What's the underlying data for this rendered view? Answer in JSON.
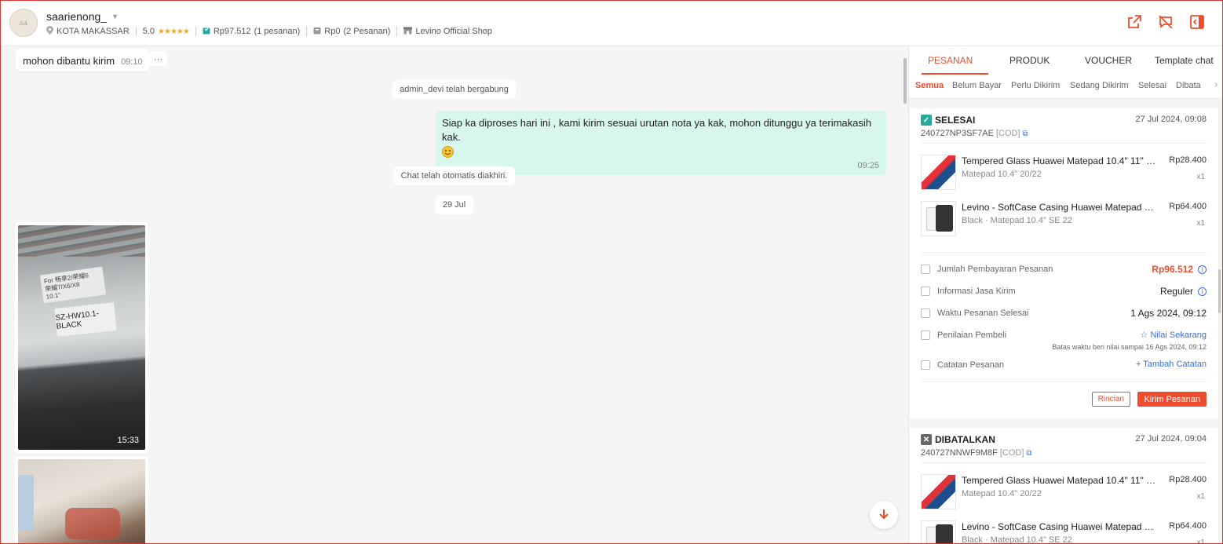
{
  "header": {
    "username": "saarienong_",
    "location": "KOTA MAKASSAR",
    "rating": "5.0",
    "stars": "★★★★★",
    "purchase_total": "Rp97.512",
    "purchase_count": "(1 pesanan)",
    "pending_total": "Rp0",
    "pending_count": "(2 Pesanan)",
    "shop": "Levino Official Shop",
    "avatar_text": "ꜱᴀ"
  },
  "chat": {
    "messages": [
      {
        "type": "received",
        "text": "mohon dibantu kirim",
        "time": "09:10"
      },
      {
        "type": "system",
        "text": "admin_devi telah bergabung"
      },
      {
        "type": "sent",
        "text": "Siap ka diproses hari ini , kami kirim sesuai urutan nota ya kak, mohon ditunggu ya terimakasih kak.",
        "time": "09:25"
      },
      {
        "type": "system",
        "text": "Chat telah otomatis diakhiri."
      },
      {
        "type": "date",
        "text": "29 Jul"
      },
      {
        "type": "video",
        "duration": "15:33",
        "label1": "For 畅享2/荣耀6\n荣耀7/X6/X8\n10.1\"",
        "label2": "SZ-HW10.1-BLACK"
      },
      {
        "type": "image"
      }
    ],
    "more_label": "···",
    "scroll_down_icon": "arrow-down-icon"
  },
  "panel": {
    "tabs": [
      "PESANAN",
      "PRODUK",
      "VOUCHER",
      "Template chat"
    ],
    "active_tab": 0,
    "subtabs": [
      "Semua",
      "Belum Bayar",
      "Perlu Dikirim",
      "Sedang Dikirim",
      "Selesai",
      "Dibata"
    ],
    "active_subtab": 0,
    "orders": [
      {
        "status": "SELESAI",
        "date": "27 Jul 2024, 09:08",
        "order_id": "240727NP3SF7AE",
        "cod": "[COD]",
        "items": [
          {
            "name": "Tempered Glass Huawei Matepad 10.4\" 11\" Pr...",
            "variant": "Matepad 10.4\" 20/22",
            "price": "Rp28.400",
            "qty": "x1"
          },
          {
            "name": "Levino - SoftCase Casing Huawei Matepad 11....",
            "variant": "Black · Matepad 10.4\" SE 22",
            "price": "Rp64.400",
            "qty": "x1"
          }
        ],
        "info": {
          "payment_label": "Jumlah Pembayaran Pesanan",
          "payment_value": "Rp96.512",
          "shipping_label": "Informasi Jasa Kirim",
          "shipping_value": "Reguler",
          "completed_label": "Waktu Pesanan Selesai",
          "completed_value": "1 Ags 2024, 09:12",
          "review_label": "Penilaian Pembeli",
          "review_value": "☆ Nilai Sekarang",
          "review_deadline": "Batas waktu beri nilai sampai 16 Ags 2024, 09:12",
          "note_label": "Catatan Pesanan",
          "note_value": "+ Tambah Catatan"
        },
        "actions": {
          "detail": "Rincian",
          "send": "Kirim Pesanan"
        }
      },
      {
        "status": "DIBATALKAN",
        "date": "27 Jul 2024, 09:04",
        "order_id": "240727NNWF9M8F",
        "cod": "[COD]",
        "items": [
          {
            "name": "Tempered Glass Huawei Matepad 10.4\" 11\" Pr...",
            "variant": "Matepad 10.4\" 20/22",
            "price": "Rp28.400",
            "qty": "x1"
          },
          {
            "name": "Levino - SoftCase Casing Huawei Matepad 11....",
            "variant": "Black · Matepad 10.4\" SE 22",
            "price": "Rp64.400",
            "qty": "x1"
          }
        ]
      }
    ]
  },
  "colors": {
    "accent": "#ee4d2d",
    "sent_bubble": "#d7f6ed",
    "link": "#3a6fd6"
  }
}
